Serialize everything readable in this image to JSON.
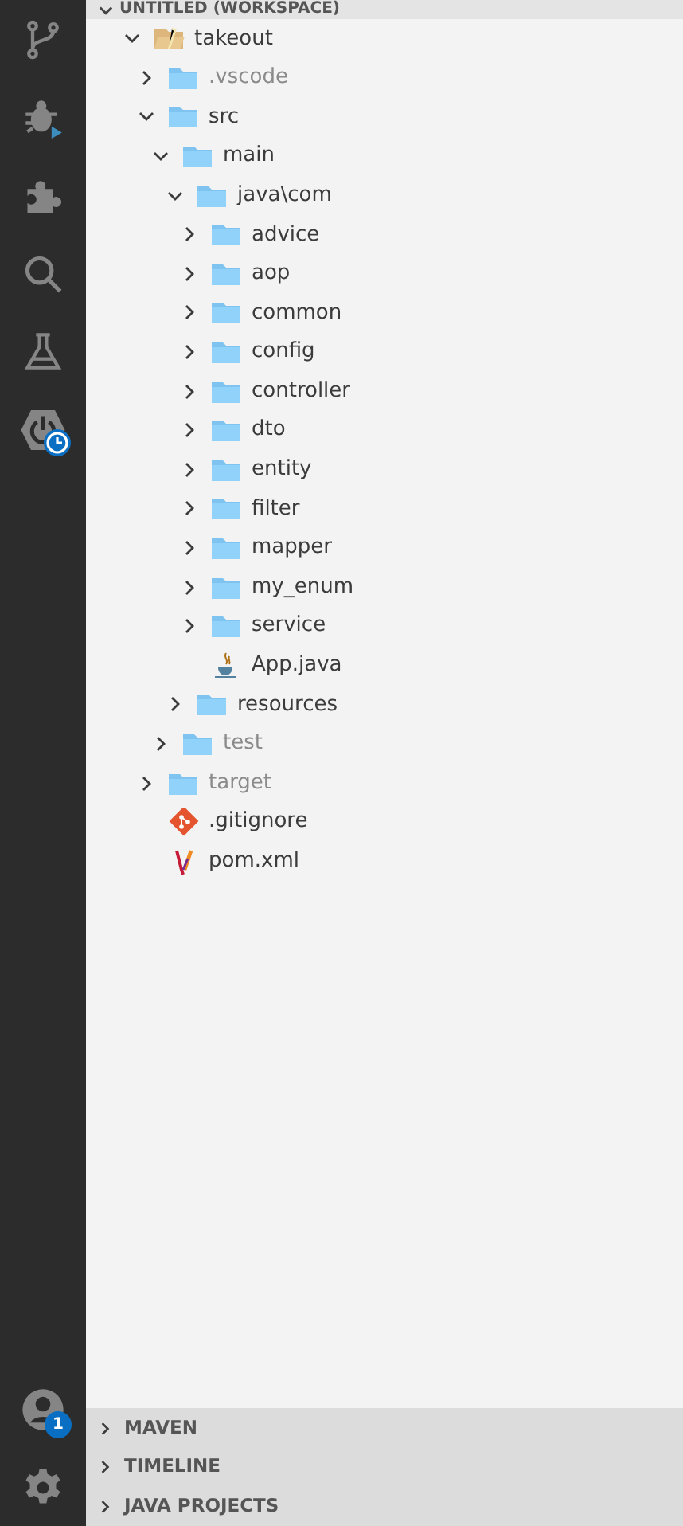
{
  "activity_bar": {
    "top": [
      {
        "kind": "branch"
      },
      {
        "kind": "bug"
      },
      {
        "kind": "puzzle"
      },
      {
        "kind": "search"
      },
      {
        "kind": "flask"
      },
      {
        "kind": "power",
        "clock_badge": true
      }
    ],
    "bottom": [
      {
        "kind": "account",
        "badge": "1"
      },
      {
        "kind": "gear"
      }
    ]
  },
  "explorer": {
    "header": "UNTITLED (WORKSPACE)",
    "expanded": true,
    "tree": [
      {
        "name": "takeout",
        "kind": "folder-open",
        "expanded": true,
        "dimmed": false,
        "children": [
          {
            "name": ".vscode",
            "kind": "folder",
            "expanded": false,
            "dimmed": true
          },
          {
            "name": "src",
            "kind": "folder",
            "expanded": true,
            "dimmed": false,
            "children": [
              {
                "name": "main",
                "kind": "folder",
                "expanded": true,
                "dimmed": false,
                "children": [
                  {
                    "name": "java\\com",
                    "kind": "folder",
                    "expanded": true,
                    "dimmed": false,
                    "children": [
                      {
                        "name": "advice",
                        "kind": "folder",
                        "expanded": false,
                        "dimmed": false
                      },
                      {
                        "name": "aop",
                        "kind": "folder",
                        "expanded": false,
                        "dimmed": false
                      },
                      {
                        "name": "common",
                        "kind": "folder",
                        "expanded": false,
                        "dimmed": false
                      },
                      {
                        "name": "config",
                        "kind": "folder",
                        "expanded": false,
                        "dimmed": false
                      },
                      {
                        "name": "controller",
                        "kind": "folder",
                        "expanded": false,
                        "dimmed": false
                      },
                      {
                        "name": "dto",
                        "kind": "folder",
                        "expanded": false,
                        "dimmed": false
                      },
                      {
                        "name": "entity",
                        "kind": "folder",
                        "expanded": false,
                        "dimmed": false
                      },
                      {
                        "name": "filter",
                        "kind": "folder",
                        "expanded": false,
                        "dimmed": false
                      },
                      {
                        "name": "mapper",
                        "kind": "folder",
                        "expanded": false,
                        "dimmed": false
                      },
                      {
                        "name": "my_enum",
                        "kind": "folder",
                        "expanded": false,
                        "dimmed": false
                      },
                      {
                        "name": "service",
                        "kind": "folder",
                        "expanded": false,
                        "dimmed": false
                      },
                      {
                        "name": "App.java",
                        "kind": "java",
                        "dimmed": false
                      }
                    ]
                  },
                  {
                    "name": "resources",
                    "kind": "folder",
                    "expanded": false,
                    "dimmed": false
                  }
                ]
              },
              {
                "name": "test",
                "kind": "folder",
                "expanded": false,
                "dimmed": true
              }
            ]
          },
          {
            "name": "target",
            "kind": "folder",
            "expanded": false,
            "dimmed": true
          },
          {
            "name": ".gitignore",
            "kind": "git",
            "dimmed": false
          },
          {
            "name": "pom.xml",
            "kind": "maven",
            "dimmed": false
          }
        ]
      }
    ]
  },
  "sections": [
    {
      "title": "MAVEN",
      "expanded": false
    },
    {
      "title": "TIMELINE",
      "expanded": false
    },
    {
      "title": "JAVA PROJECTS",
      "expanded": false
    }
  ]
}
